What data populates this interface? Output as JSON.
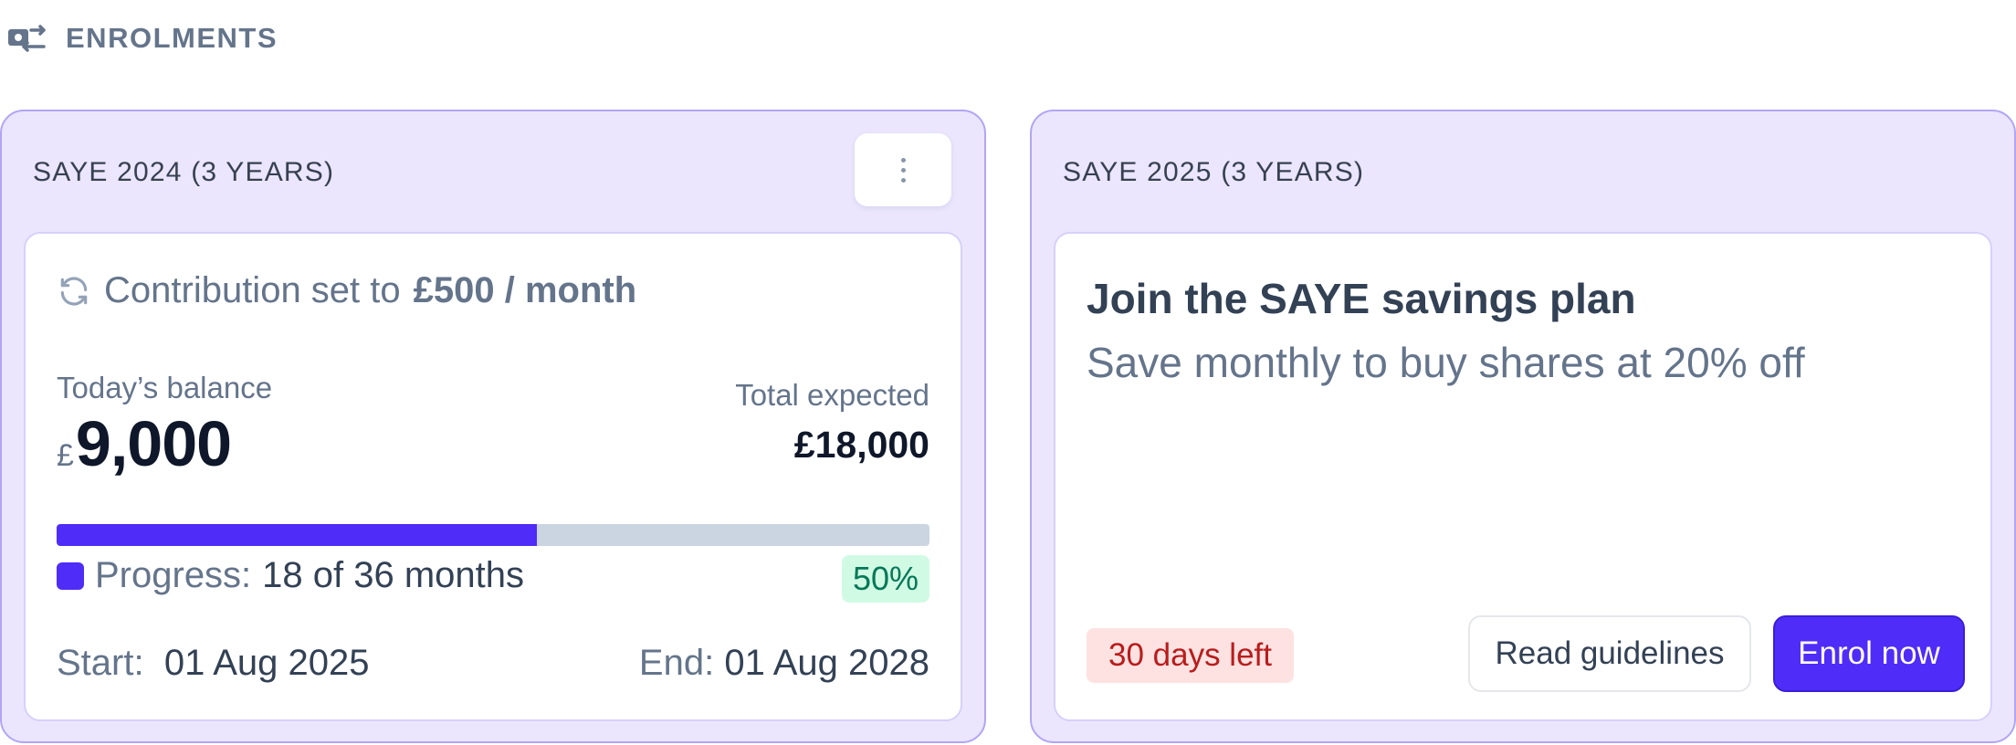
{
  "section": {
    "title": "ENROLMENTS",
    "icon": "enrolment-swap-icon"
  },
  "colors": {
    "accent": "#4f2cf7",
    "card_bg": "#ebe6fd",
    "card_border": "#b3a5f5",
    "badge_success_bg": "#d1fae5",
    "badge_success_text": "#047857",
    "badge_danger_bg": "#fee2e2",
    "badge_danger_text": "#b91c1c"
  },
  "plans": [
    {
      "title": "SAYE 2024 (3 YEARS)",
      "menu_icon": "more-vertical-icon",
      "contribution": {
        "icon": "refresh-icon",
        "prefix": "Contribution set to",
        "amount": "£500 / month"
      },
      "balance": {
        "label": "Today’s balance",
        "currency": "£",
        "amount": "9,000"
      },
      "expected": {
        "label": "Total expected",
        "amount": "£18,000"
      },
      "progress": {
        "label": "Progress:",
        "value": "18 of 36 months",
        "percent_text": "50%",
        "fill_fraction": 0.55
      },
      "start": {
        "label": "Start:",
        "value": "01 Aug 2025"
      },
      "end": {
        "label": "End:",
        "value": "01 Aug 2028"
      }
    },
    {
      "title": "SAYE 2025 (3 YEARS)",
      "promo": {
        "title": "Join the SAYE savings plan",
        "subtitle": "Save monthly to buy shares at 20% off",
        "days_left": "30 days left",
        "secondary_button": "Read guidelines",
        "primary_button": "Enrol now"
      }
    }
  ]
}
